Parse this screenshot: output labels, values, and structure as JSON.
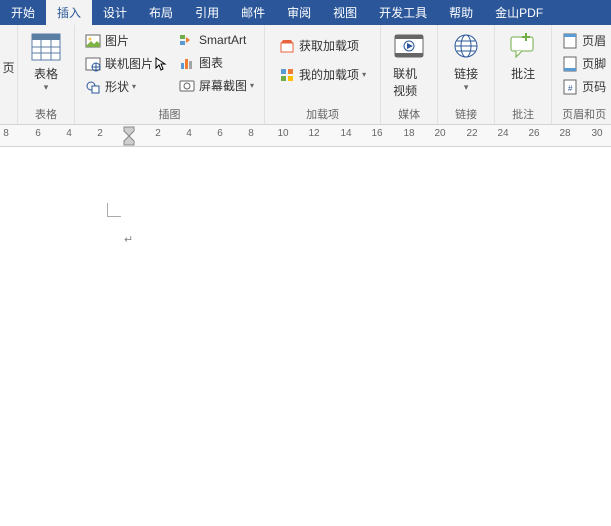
{
  "tabs": {
    "t0": "开始",
    "t1": "插入",
    "t2": "设计",
    "t3": "布局",
    "t4": "引用",
    "t5": "邮件",
    "t6": "审阅",
    "t7": "视图",
    "t8": "开发工具",
    "t9": "帮助",
    "t10": "金山PDF"
  },
  "ribbon": {
    "truncated_left": "页",
    "tables": {
      "label": "表格",
      "btn": "表格"
    },
    "illus": {
      "label": "插图",
      "pic": "图片",
      "online_pic": "联机图片",
      "shapes": "形状",
      "smartart": "SmartArt",
      "chart": "图表",
      "screenshot": "屏幕截图"
    },
    "addins": {
      "label": "加载项",
      "get": "获取加载项",
      "my": "我的加载项"
    },
    "media": {
      "label": "媒体",
      "video": "联机视频"
    },
    "links": {
      "label": "链接",
      "link": "链接"
    },
    "comments": {
      "label": "批注",
      "comment": "批注"
    },
    "headerfooter": {
      "label": "页眉和页",
      "header": "页眉",
      "footer": "页脚",
      "num": "页码"
    }
  },
  "ruler_numbers": [
    "8",
    "6",
    "4",
    "2",
    "2",
    "4",
    "6",
    "8",
    "10",
    "12",
    "14",
    "16",
    "18",
    "20",
    "22",
    "24",
    "26",
    "28",
    "30"
  ],
  "colors": {
    "accent": "#2b579a",
    "ribbon_bg": "#f3f3f3"
  }
}
